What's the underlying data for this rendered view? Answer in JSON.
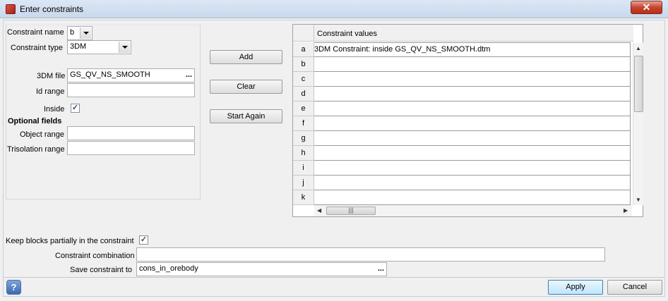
{
  "window": {
    "title": "Enter constraints",
    "close_glyph": "✕"
  },
  "form": {
    "constraint_name_label": "Constraint name",
    "constraint_name_value": "b",
    "constraint_type_label": "Constraint type",
    "constraint_type_value": "3DM",
    "file_label": "3DM file",
    "file_value": "GS_QV_NS_SMOOTH",
    "id_range_label": "Id range",
    "id_range_value": "",
    "inside_label": "Inside",
    "inside_checked": true,
    "optional_fields_label": "Optional fields",
    "object_range_label": "Object range",
    "object_range_value": "",
    "trisolation_range_label": "Trisolation range",
    "trisolation_range_value": "",
    "ellipsis": "..."
  },
  "actions": {
    "add": "Add",
    "clear": "Clear",
    "start_again": "Start Again"
  },
  "table": {
    "header": "Constraint values",
    "rows": [
      {
        "key": "a",
        "value": "3DM Constraint: inside GS_QV_NS_SMOOTH.dtm"
      },
      {
        "key": "b",
        "value": ""
      },
      {
        "key": "c",
        "value": ""
      },
      {
        "key": "d",
        "value": ""
      },
      {
        "key": "e",
        "value": ""
      },
      {
        "key": "f",
        "value": ""
      },
      {
        "key": "g",
        "value": ""
      },
      {
        "key": "h",
        "value": ""
      },
      {
        "key": "i",
        "value": ""
      },
      {
        "key": "j",
        "value": ""
      },
      {
        "key": "k",
        "value": ""
      }
    ]
  },
  "bottom": {
    "keep_blocks_label": "Keep blocks partially in the constraint",
    "keep_blocks_checked": true,
    "combination_label": "Constraint combination",
    "combination_value": "",
    "save_label": "Save constraint to",
    "save_value": "cons_in_orebody"
  },
  "footer": {
    "help": "?",
    "apply": "Apply",
    "cancel": "Cancel"
  },
  "check_glyph": "✓"
}
